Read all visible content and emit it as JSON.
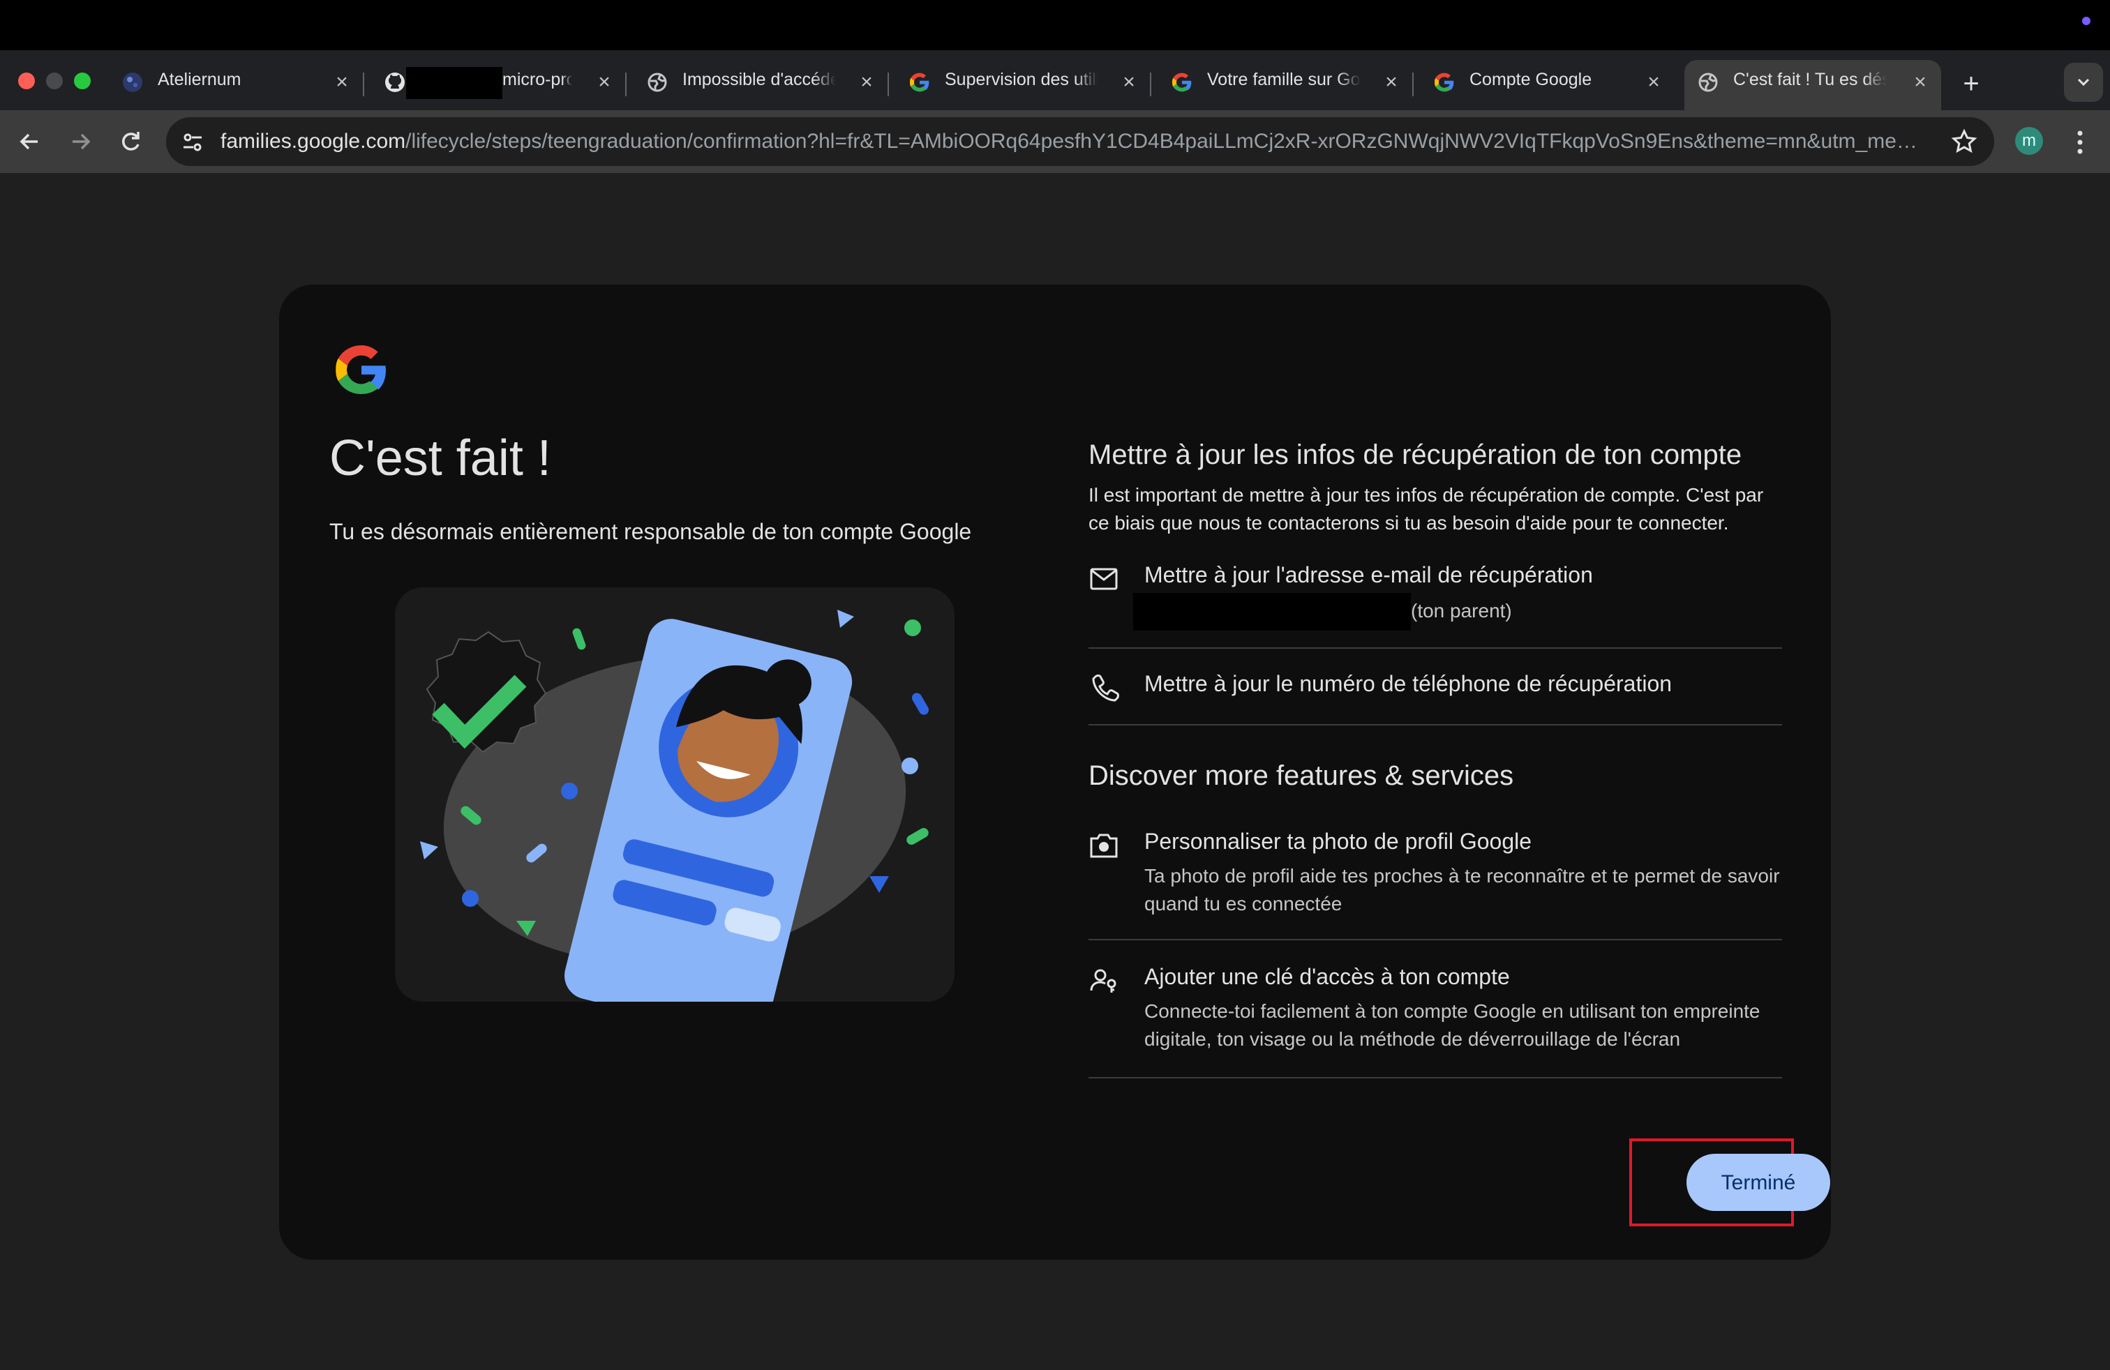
{
  "browser": {
    "tabs": [
      {
        "label": "Ateliernum",
        "icon": "globe-dark-icon",
        "active": false
      },
      {
        "label": "micro-proj",
        "icon": "github-icon",
        "active": false
      },
      {
        "label": "Impossible d'accéde",
        "icon": "globe-icon",
        "active": false
      },
      {
        "label": "Supervision des utili",
        "icon": "google-g-icon",
        "active": false
      },
      {
        "label": "Votre famille sur Goo",
        "icon": "google-g-icon",
        "active": false
      },
      {
        "label": "Compte Google",
        "icon": "google-g-icon",
        "active": false
      },
      {
        "label": "C'est fait ! Tu es dés",
        "icon": "globe-icon",
        "active": true
      }
    ],
    "url_host": "families.google.com",
    "url_path": "/lifecycle/steps/teengraduation/confirmation?hl=fr&TL=AMbiOORq64pesfhY1CD4B4paiLLmCj2xR-xrORzGNWqjNWV2VIqTFkqpVoSn9Ens&theme=mn&utm_medium...",
    "profile_initial": "m",
    "accent_color": "#7b5cff"
  },
  "page": {
    "headline": "C'est fait !",
    "subhead": "Tu es désormais entièrement responsable de ton compte Google",
    "recovery": {
      "title": "Mettre à jour les infos de récupération de ton compte",
      "description": "Il est important de mettre à jour tes infos de récupération de compte. C'est par ce biais que nous te contacterons si tu as besoin d'aide pour te connecter.",
      "email_item": {
        "title": "Mettre à jour l'adresse e-mail de récupération",
        "note": "(ton parent)",
        "icon": "mail-icon"
      },
      "phone_item": {
        "title": "Mettre à jour le numéro de téléphone de récupération",
        "icon": "phone-icon"
      }
    },
    "discover": {
      "title": "Discover more features & services",
      "photo_item": {
        "title": "Personnaliser ta photo de profil Google",
        "subtitle": "Ta photo de profil aide tes proches à te reconnaître et te permet de savoir quand tu es connectée",
        "icon": "camera-icon"
      },
      "passkey_item": {
        "title": "Ajouter une clé d'accès à ton compte",
        "subtitle": "Connecte-toi facilement à ton compte Google en utilisant ton empreinte digitale, ton visage ou la méthode de déverrouillage de l'écran",
        "icon": "passkey-icon"
      }
    },
    "done_button": "Terminé",
    "button_color": "#a8c7fa",
    "highlight_color": "#e0182a"
  }
}
